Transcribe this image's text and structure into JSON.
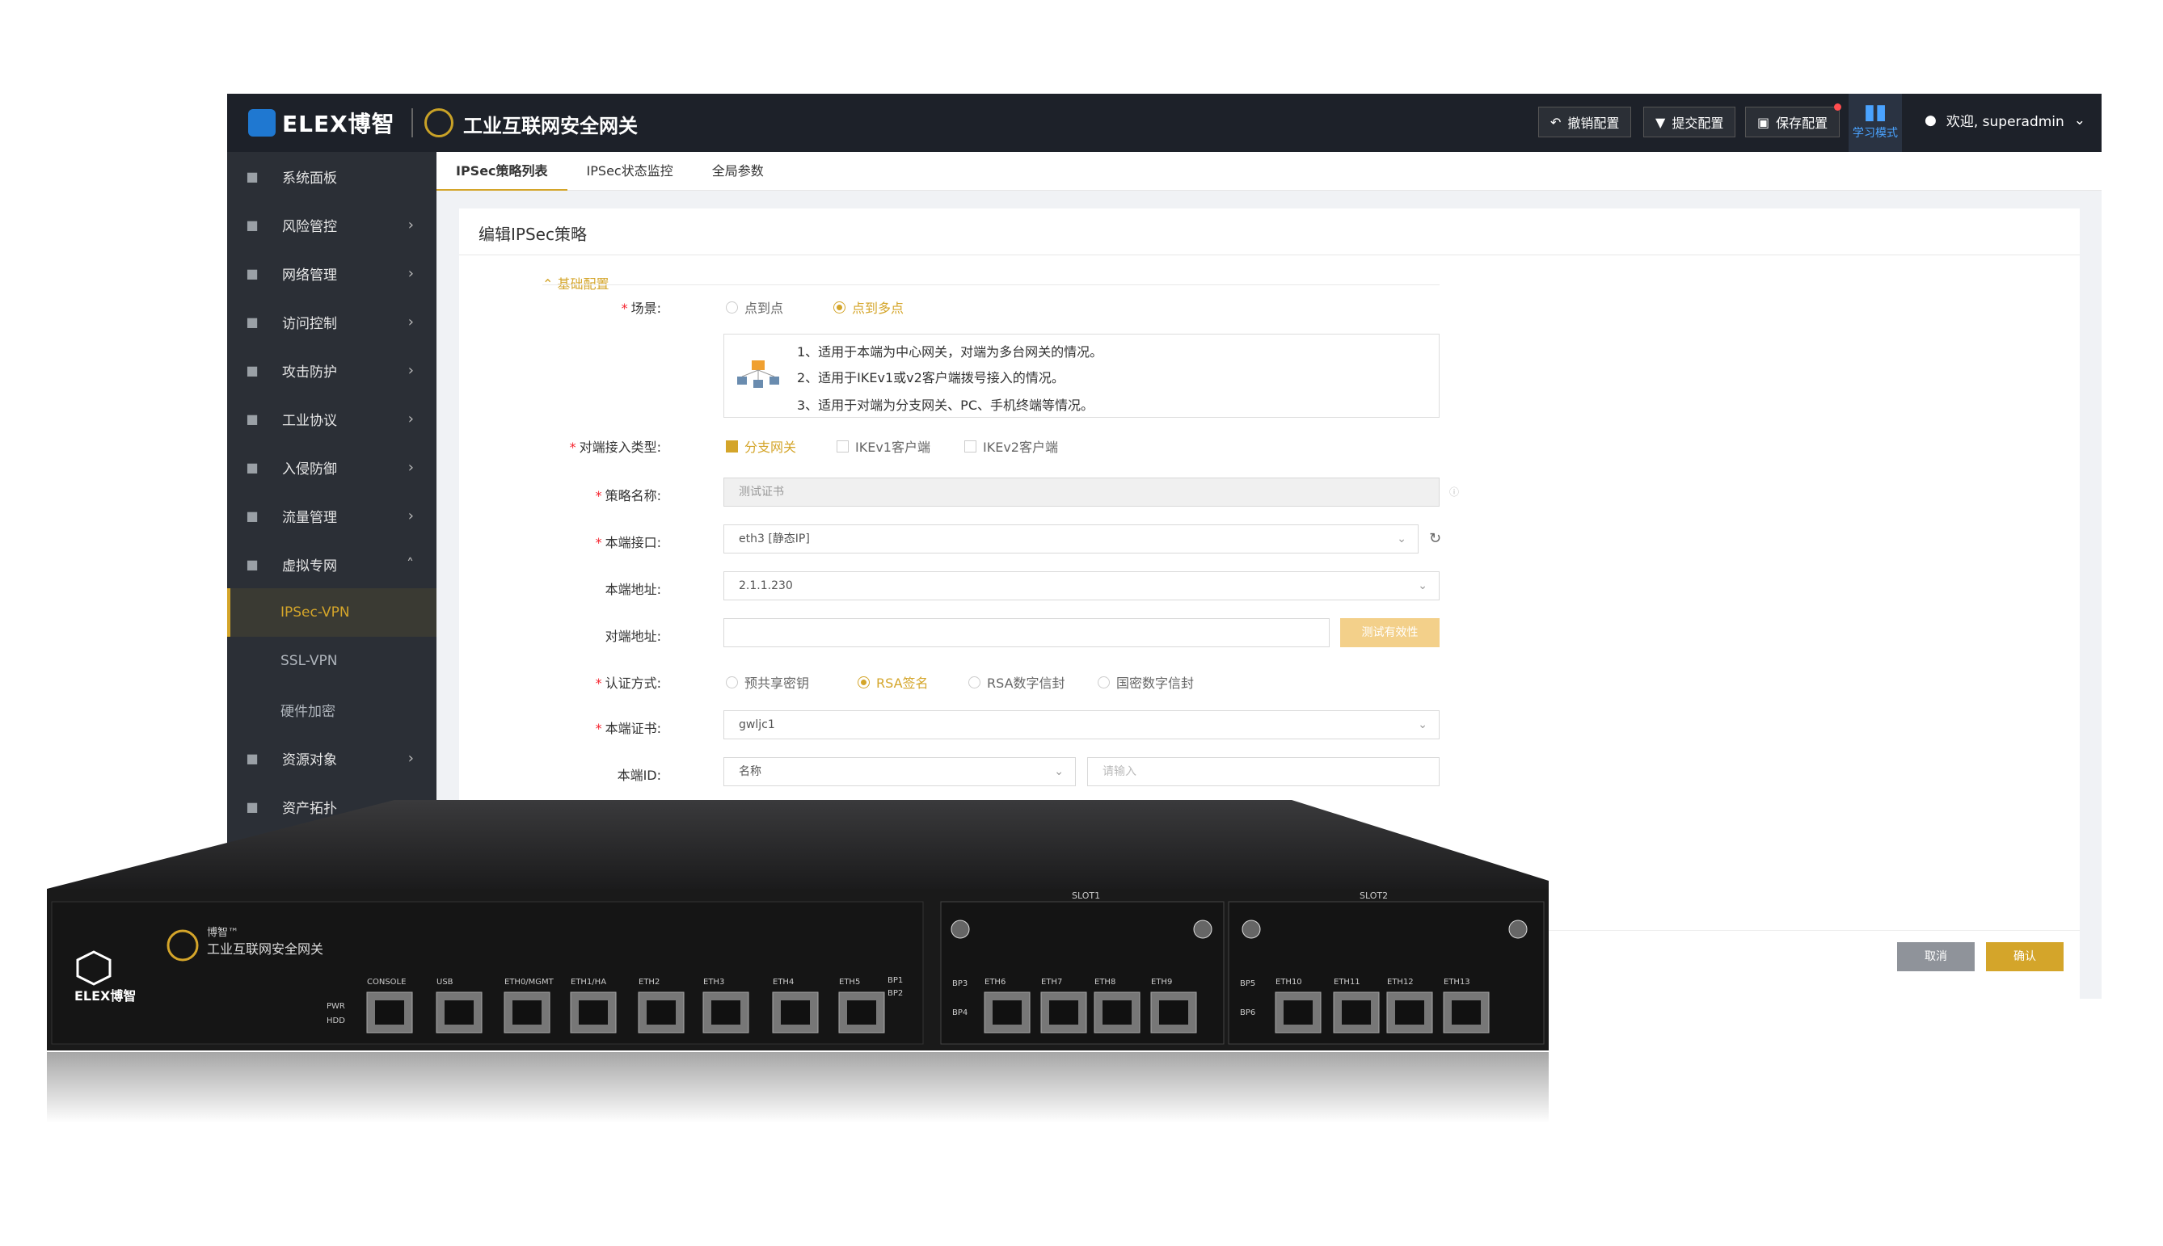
{
  "brand": {
    "logo": "ELEX博智",
    "product": "工业互联网安全网关"
  },
  "toolbar": {
    "undo": "撤销配置",
    "submit": "提交配置",
    "save": "保存配置",
    "learn": "学习模式",
    "welcome": "欢迎, superadmin"
  },
  "sidebar": {
    "items": [
      {
        "icon": "dashboard-icon",
        "label": "系统面板",
        "chev": ""
      },
      {
        "icon": "shield-icon",
        "label": "风险管控",
        "chev": "›"
      },
      {
        "icon": "network-icon",
        "label": "网络管理",
        "chev": "›"
      },
      {
        "icon": "grid-icon",
        "label": "访问控制",
        "chev": "›"
      },
      {
        "icon": "virus-icon",
        "label": "攻击防护",
        "chev": "›"
      },
      {
        "icon": "factory-icon",
        "label": "工业协议",
        "chev": "›"
      },
      {
        "icon": "intrusion-icon",
        "label": "入侵防御",
        "chev": "›"
      },
      {
        "icon": "chart-icon",
        "label": "流量管理",
        "chev": "›"
      },
      {
        "icon": "globe-icon",
        "label": "虚拟专网",
        "chev": "˄"
      }
    ],
    "subitems": [
      "IPSec-VPN",
      "SSL-VPN",
      "硬件加密"
    ],
    "more": [
      {
        "icon": "database-icon",
        "label": "资源对象",
        "chev": "›"
      },
      {
        "icon": "topology-icon",
        "label": "资产拓扑",
        "chev": "›"
      }
    ]
  },
  "tabs": [
    "IPSec策略列表",
    "IPSec状态监控",
    "全局参数"
  ],
  "form": {
    "title": "编辑IPSec策略",
    "section": "基础配置",
    "scene": {
      "label": "场景:",
      "options": [
        "点到点",
        "点到多点"
      ]
    },
    "desc": [
      "1、适用于本端为中心网关，对端为多台网关的情况。",
      "2、适用于IKEv1或v2客户端拨号接入的情况。",
      "3、适用于对端为分支网关、PC、手机终端等情况。"
    ],
    "peer_type": {
      "label": "对端接入类型:",
      "options": [
        "分支网关",
        "IKEv1客户端",
        "IKEv2客户端"
      ]
    },
    "name": {
      "label": "策略名称:",
      "value": "测试证书"
    },
    "local_if": {
      "label": "本端接口:",
      "value": "eth3 [静态IP]"
    },
    "local_addr": {
      "label": "本端地址:",
      "value": "2.1.1.230"
    },
    "peer_addr": {
      "label": "对端地址:",
      "value": "",
      "test": "测试有效性"
    },
    "auth": {
      "label": "认证方式:",
      "options": [
        "预共享密钥",
        "RSA签名",
        "RSA数字信封",
        "国密数字信封"
      ]
    },
    "cert": {
      "label": "本端证书:",
      "value": "gwljc1"
    },
    "local_id": {
      "label": "本端ID:",
      "value": "名称",
      "placeholder": "请输入"
    },
    "cancel": "取消",
    "ok": "确认"
  },
  "device": {
    "brand": "ELEX博智",
    "product": "工业互联网安全网关",
    "tm": "博智™",
    "ports": [
      "CONSOLE",
      "USB",
      "ETH0/MGMT",
      "ETH1/HA",
      "ETH2",
      "ETH3",
      "ETH4",
      "ETH5",
      "ETH6",
      "ETH7",
      "ETH8",
      "ETH9",
      "ETH10",
      "ETH11",
      "ETH12",
      "ETH13"
    ],
    "slots": [
      "SLOT1",
      "SLOT2"
    ],
    "leds": [
      "PWR",
      "HDD"
    ],
    "bp": [
      "BP1",
      "BP2",
      "BP3",
      "BP4",
      "BP5",
      "BP6"
    ]
  }
}
